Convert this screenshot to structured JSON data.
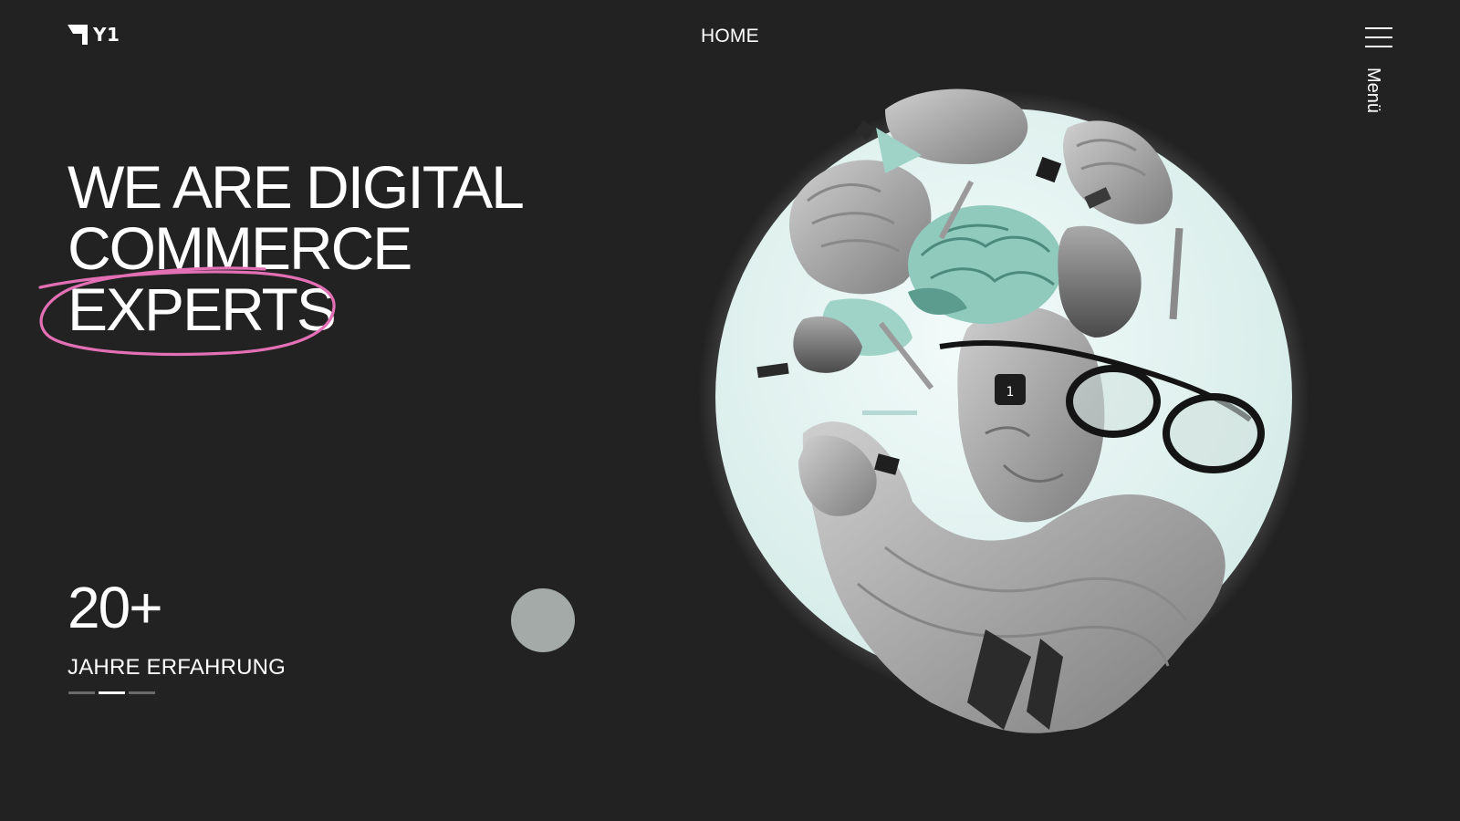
{
  "header": {
    "logo_text": "Y1",
    "nav_home": "HOME",
    "menu_label": "Menü"
  },
  "hero": {
    "headline_lines": [
      "WE ARE DIGITAL",
      "COMMERCE",
      "EXPERTS"
    ],
    "highlight_color": "#e36fb5"
  },
  "stats": {
    "number": "20+",
    "label": "JAHRE ERFAHRUNG",
    "slides": [
      {
        "active": false
      },
      {
        "active": true
      },
      {
        "active": false
      }
    ]
  },
  "art": {
    "glasses_badge": "1",
    "moon_color": "#e6f5f3",
    "accent_color": "#7fc4b4"
  }
}
